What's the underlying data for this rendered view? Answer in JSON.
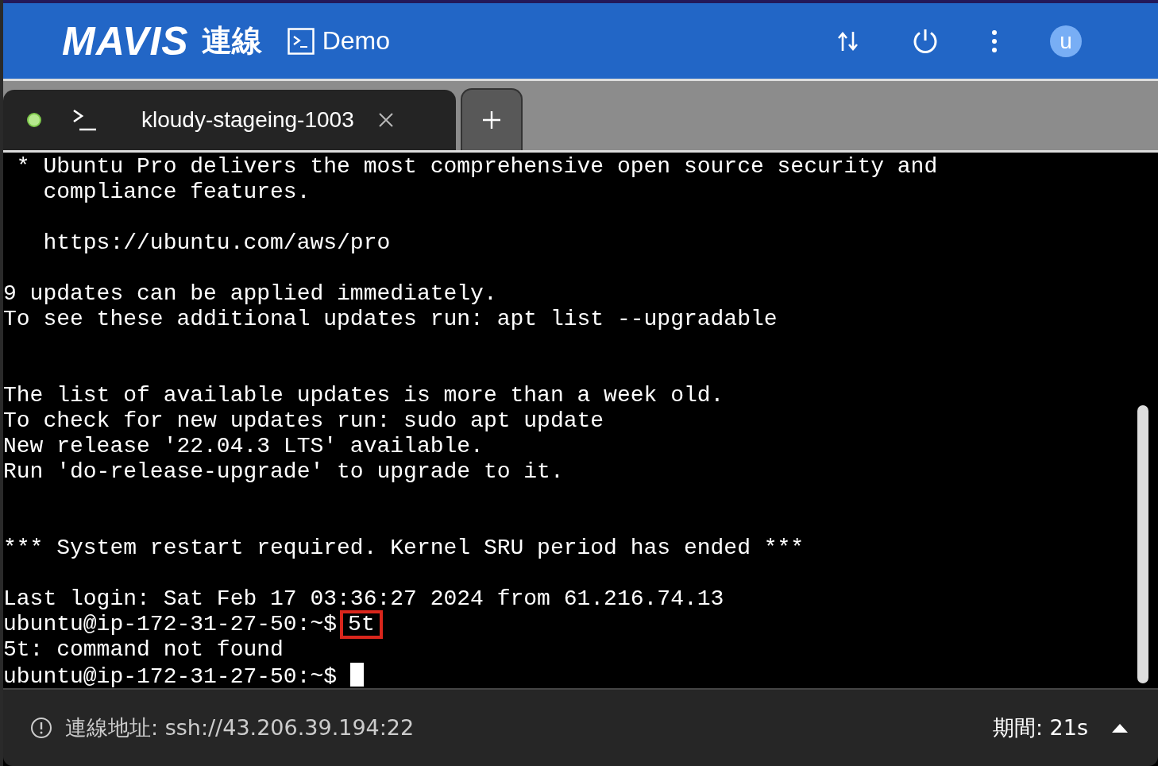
{
  "header": {
    "logo": "MAVIS",
    "logo_suffix": "連線",
    "workspace": "Demo",
    "avatar": "u"
  },
  "tabs": [
    {
      "label": "kloudy-stageing-1003",
      "selected": true,
      "connected": true
    }
  ],
  "terminal": {
    "lines": [
      {
        "kind": "text",
        "text": " * Ubuntu Pro delivers the most comprehensive open source security and"
      },
      {
        "kind": "text",
        "text": "   compliance features."
      },
      {
        "kind": "blank"
      },
      {
        "kind": "text",
        "text": "   https://ubuntu.com/aws/pro"
      },
      {
        "kind": "blank"
      },
      {
        "kind": "text",
        "text": "9 updates can be applied immediately."
      },
      {
        "kind": "text",
        "text": "To see these additional updates run: apt list --upgradable"
      },
      {
        "kind": "blank"
      },
      {
        "kind": "blank"
      },
      {
        "kind": "text",
        "text": "The list of available updates is more than a week old."
      },
      {
        "kind": "text",
        "text": "To check for new updates run: sudo apt update"
      },
      {
        "kind": "text",
        "text": "New release '22.04.3 LTS' available."
      },
      {
        "kind": "text",
        "text": "Run 'do-release-upgrade' to upgrade to it."
      },
      {
        "kind": "blank"
      },
      {
        "kind": "blank"
      },
      {
        "kind": "text",
        "text": "*** System restart required. Kernel SRU period has ended ***"
      },
      {
        "kind": "blank"
      },
      {
        "kind": "text",
        "text": "Last login: Sat Feb 17 03:36:27 2024 from 61.216.74.13"
      },
      {
        "kind": "command",
        "prompt": "ubuntu@ip-172-31-27-50:~$",
        "command": "5t",
        "highlighted": true
      },
      {
        "kind": "text",
        "text": "5t: command not found"
      },
      {
        "kind": "cursor",
        "prompt": "ubuntu@ip-172-31-27-50:~$"
      }
    ]
  },
  "status_bar": {
    "address": "連線地址: ssh://43.206.39.194:22",
    "duration": "期間: 21s"
  }
}
